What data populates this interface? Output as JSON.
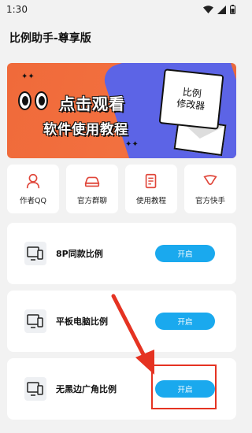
{
  "status": {
    "time": "1:30"
  },
  "app": {
    "title": "比例助手-尊享版"
  },
  "banner": {
    "headline": "点击观看",
    "subheadline": "软件使用教程",
    "note_line1": "比例",
    "note_line2": "修改器"
  },
  "shortcuts": [
    {
      "label": "作者QQ",
      "icon": "person-icon"
    },
    {
      "label": "官方群聊",
      "icon": "car-icon"
    },
    {
      "label": "使用教程",
      "icon": "document-icon"
    },
    {
      "label": "官方快手",
      "icon": "kuaishou-icon"
    }
  ],
  "cards": [
    {
      "label": "8P同款比例",
      "button": "开启"
    },
    {
      "label": "平板电脑比例",
      "button": "开启"
    },
    {
      "label": "无黑边广角比例",
      "button": "开启"
    }
  ],
  "colors": {
    "accent": "#1aa9ee",
    "banner_orange": "#f06a3a",
    "banner_blue": "#5c64e6",
    "icon_red": "#e0463a",
    "highlight_red": "#e53322"
  }
}
